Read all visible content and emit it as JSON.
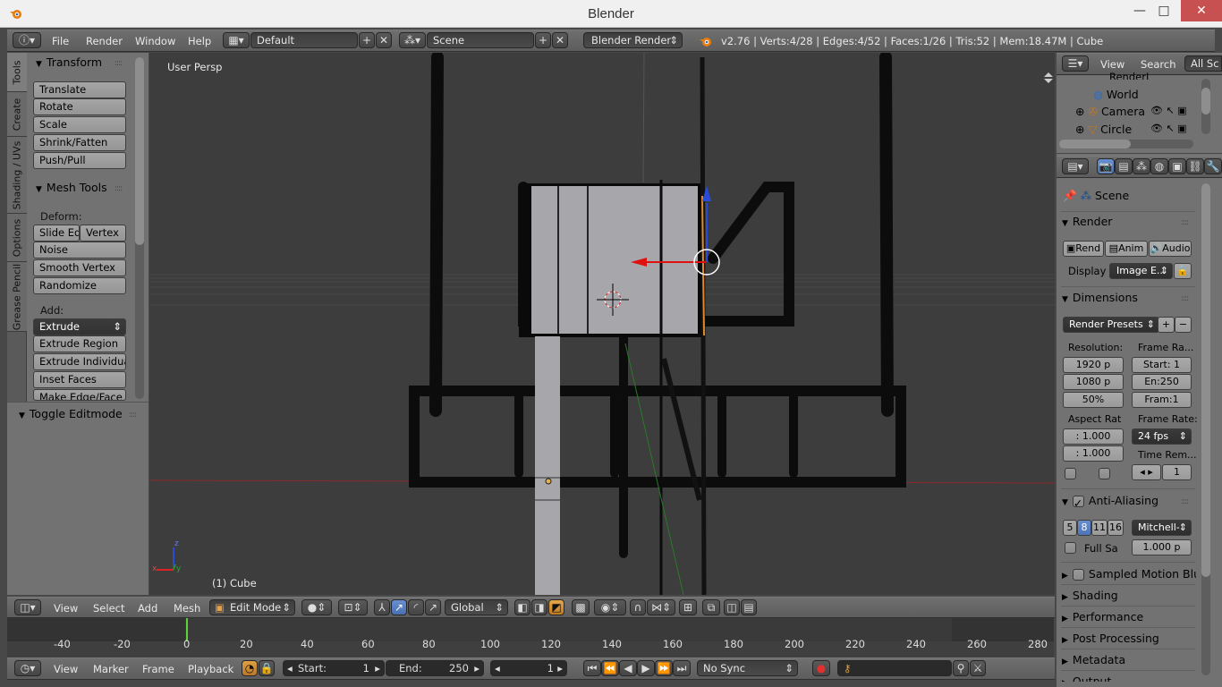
{
  "window": {
    "title": "Blender",
    "minimize": "—",
    "maximize": "□",
    "close": "✕"
  },
  "menu": {
    "items": [
      "File",
      "Render",
      "Window",
      "Help"
    ],
    "layout": "Default",
    "scene": "Scene",
    "engine": "Blender Render",
    "stats": "v2.76 | Verts:4/28 | Edges:4/52 | Faces:1/26 | Tris:52 | Mem:18.47M | Cube"
  },
  "tool_tabs": [
    "Tools",
    "Create",
    "Shading / UVs",
    "Options",
    "Grease Pencil"
  ],
  "transform": {
    "title": "Transform",
    "buttons": [
      "Translate",
      "Rotate",
      "Scale",
      "Shrink/Fatten",
      "Push/Pull"
    ]
  },
  "mesh_tools": {
    "title": "Mesh Tools",
    "deform_label": "Deform:",
    "slide_edge": "Slide Ed",
    "vertex": "Vertex",
    "buttons": [
      "Noise",
      "Smooth Vertex",
      "Randomize"
    ],
    "add_label": "Add:",
    "extrude": "Extrude",
    "add_buttons": [
      "Extrude Region",
      "Extrude Individual",
      "Inset Faces",
      "Make Edge/Face"
    ]
  },
  "toggle_editmode": "Toggle Editmode",
  "viewport": {
    "view_name": "User Persp",
    "object_label": "(1) Cube",
    "axis_x": "x",
    "axis_y": "y",
    "axis_z": "z"
  },
  "view_header": {
    "items": [
      "View",
      "Select",
      "Add",
      "Mesh"
    ],
    "mode": "Edit Mode",
    "orientation": "Global"
  },
  "outliner": {
    "view": "View",
    "search": "Search",
    "filter": "All Sc",
    "items": [
      "RenderL",
      "World",
      "Camera",
      "Circle"
    ]
  },
  "properties": {
    "scene": "Scene",
    "render_title": "Render",
    "render_btn": "Rend",
    "anim_btn": "Anim",
    "audio_btn": "Audio",
    "display_label": "Display",
    "display_value": "Image E...",
    "dimensions_title": "Dimensions",
    "render_presets": "Render Presets",
    "resolution_label": "Resolution:",
    "res_x": "1920 p",
    "res_y": "1080 p",
    "res_pct": "50%",
    "frame_range_label": "Frame Ra...",
    "start": "Start: 1",
    "end": "En:250",
    "frame": "Fram:1",
    "aspect_label": "Aspect Rat",
    "aspect_x": ": 1.000",
    "aspect_y": ": 1.000",
    "frame_rate_label": "Frame Rate:",
    "fps": "24 fps",
    "time_remap_label": "Time Rem...",
    "time_remap": "1",
    "aa_title": "Anti-Aliasing",
    "aa_levels": [
      "5",
      "8",
      "11",
      "16"
    ],
    "aa_filter": "Mitchell-",
    "full_sample": "Full Sa",
    "filter_size": "1.000 p",
    "sampled_motion": "Sampled Motion Blur",
    "shading": "Shading",
    "performance": "Performance",
    "post_processing": "Post Processing",
    "metadata": "Metadata",
    "output": "Output"
  },
  "timeline": {
    "ticks": [
      "-40",
      "-20",
      "0",
      "20",
      "40",
      "60",
      "80",
      "100",
      "120",
      "140",
      "160",
      "180",
      "200",
      "220",
      "240",
      "260",
      "280"
    ]
  },
  "timeline_header": {
    "items": [
      "View",
      "Marker",
      "Frame",
      "Playback"
    ],
    "start_label": "Start:",
    "start": "1",
    "end_label": "End:",
    "end": "250",
    "current": "1",
    "sync": "No Sync"
  }
}
